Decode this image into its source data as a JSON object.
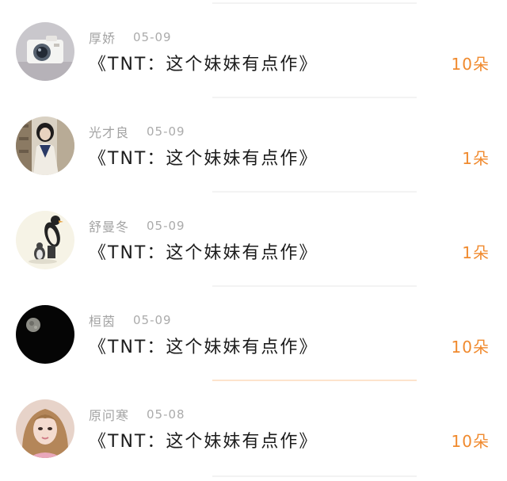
{
  "gifts": [
    {
      "user": "厚娇",
      "date": "05-09",
      "title": "《TNT：这个妹妹有点作》",
      "count": "10朵",
      "avatar_icon": "camera-photo-icon"
    },
    {
      "user": "光才良",
      "date": "05-09",
      "title": "《TNT：这个妹妹有点作》",
      "count": "1朵",
      "avatar_icon": "girl-photo-icon"
    },
    {
      "user": "舒曼冬",
      "date": "05-09",
      "title": "《TNT：这个妹妹有点作》",
      "count": "1朵",
      "avatar_icon": "penguin-icon"
    },
    {
      "user": "桓茵",
      "date": "05-09",
      "title": "《TNT：这个妹妹有点作》",
      "count": "10朵",
      "avatar_icon": "moon-icon"
    },
    {
      "user": "原问寒",
      "date": "05-08",
      "title": "《TNT：这个妹妹有点作》",
      "count": "10朵",
      "avatar_icon": "selfie-photo-icon"
    }
  ],
  "colors": {
    "count": "#f08a2e",
    "meta": "#a3a3a3",
    "title": "#1c1c1c"
  }
}
